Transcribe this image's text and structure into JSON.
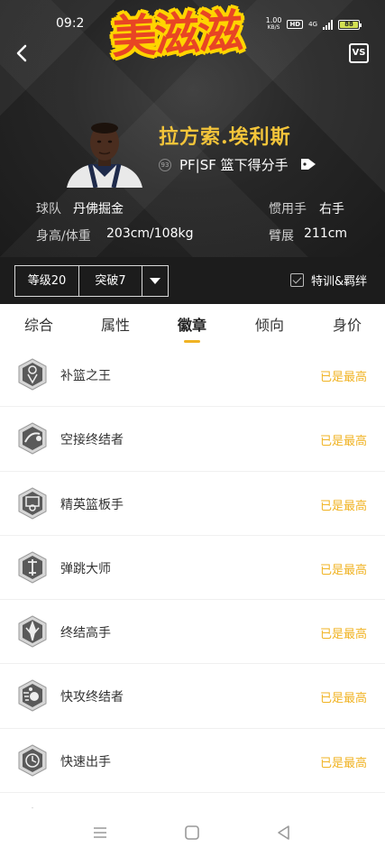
{
  "status_bar": {
    "time": "09:2",
    "net_speed_value": "1.00",
    "net_speed_unit": "KB/S",
    "hd": "HD",
    "network": "4G",
    "battery": "88"
  },
  "watermark": {
    "text": "美滋滋"
  },
  "header": {
    "back_icon": "chevron-left-icon",
    "vs_label": "VS"
  },
  "player": {
    "name": "拉方索.埃利斯",
    "rating": "93",
    "role": "PF|SF 篮下得分手",
    "team_label": "球队",
    "team_value": "丹佛掘金",
    "hand_label": "惯用手",
    "hand_value": "右手",
    "hw_label": "身高/体重",
    "hw_value": "203cm/108kg",
    "wingspan_label": "臂展",
    "wingspan_value": "211cm"
  },
  "level_bar": {
    "level": "等级20",
    "breakthrough": "突破7",
    "checkbox_label": "特训&羁绊",
    "checkbox_checked": true
  },
  "tabs": [
    {
      "label": "综合",
      "active": false
    },
    {
      "label": "属性",
      "active": false
    },
    {
      "label": "徽章",
      "active": true
    },
    {
      "label": "倾向",
      "active": false
    },
    {
      "label": "身价",
      "active": false
    }
  ],
  "badges": [
    {
      "name": "补篮之王",
      "status": "已是最高",
      "icon": "putback-icon"
    },
    {
      "name": "空接终结者",
      "status": "已是最高",
      "icon": "alley-oop-icon"
    },
    {
      "name": "精英篮板手",
      "status": "已是最高",
      "icon": "rebound-icon"
    },
    {
      "name": "弹跳大师",
      "status": "已是最高",
      "icon": "jump-icon"
    },
    {
      "name": "终结高手",
      "status": "已是最高",
      "icon": "finisher-icon"
    },
    {
      "name": "快攻终结者",
      "status": "已是最高",
      "icon": "fastbreak-icon"
    },
    {
      "name": "快速出手",
      "status": "已是最高",
      "icon": "quick-release-icon"
    }
  ],
  "nav": {
    "menu_icon": "menu-icon",
    "home_icon": "home-icon",
    "back_icon": "back-triangle-icon"
  },
  "colors": {
    "gold": "#f0b323",
    "name_gold": "#f3c43a",
    "dark_bg": "#1c1c1c"
  }
}
